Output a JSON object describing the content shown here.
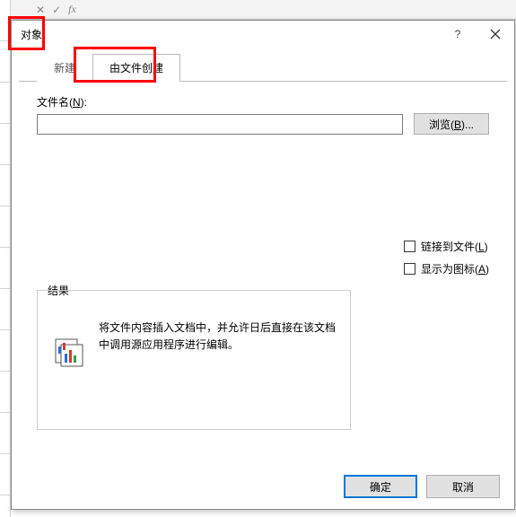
{
  "formula_bar": {
    "fx": "fx"
  },
  "dialog": {
    "title": "对象",
    "help": "?",
    "tabs": {
      "new": "新建",
      "from_file": "由文件创建"
    },
    "filename_label_pre": "文件名(",
    "filename_label_u": "N",
    "filename_label_post": "):",
    "filename_value": "",
    "browse_pre": "浏览(",
    "browse_u": "B",
    "browse_post": ")...",
    "link_pre": "链接到文件(",
    "link_u": "L",
    "link_post": ")",
    "icon_pre": "显示为图标(",
    "icon_u": "A",
    "icon_post": ")",
    "result_legend": "结果",
    "result_text": "将文件内容插入文档中，并允许日后直接在该文档中调用源应用程序进行编辑。",
    "ok": "确定",
    "cancel": "取消"
  }
}
